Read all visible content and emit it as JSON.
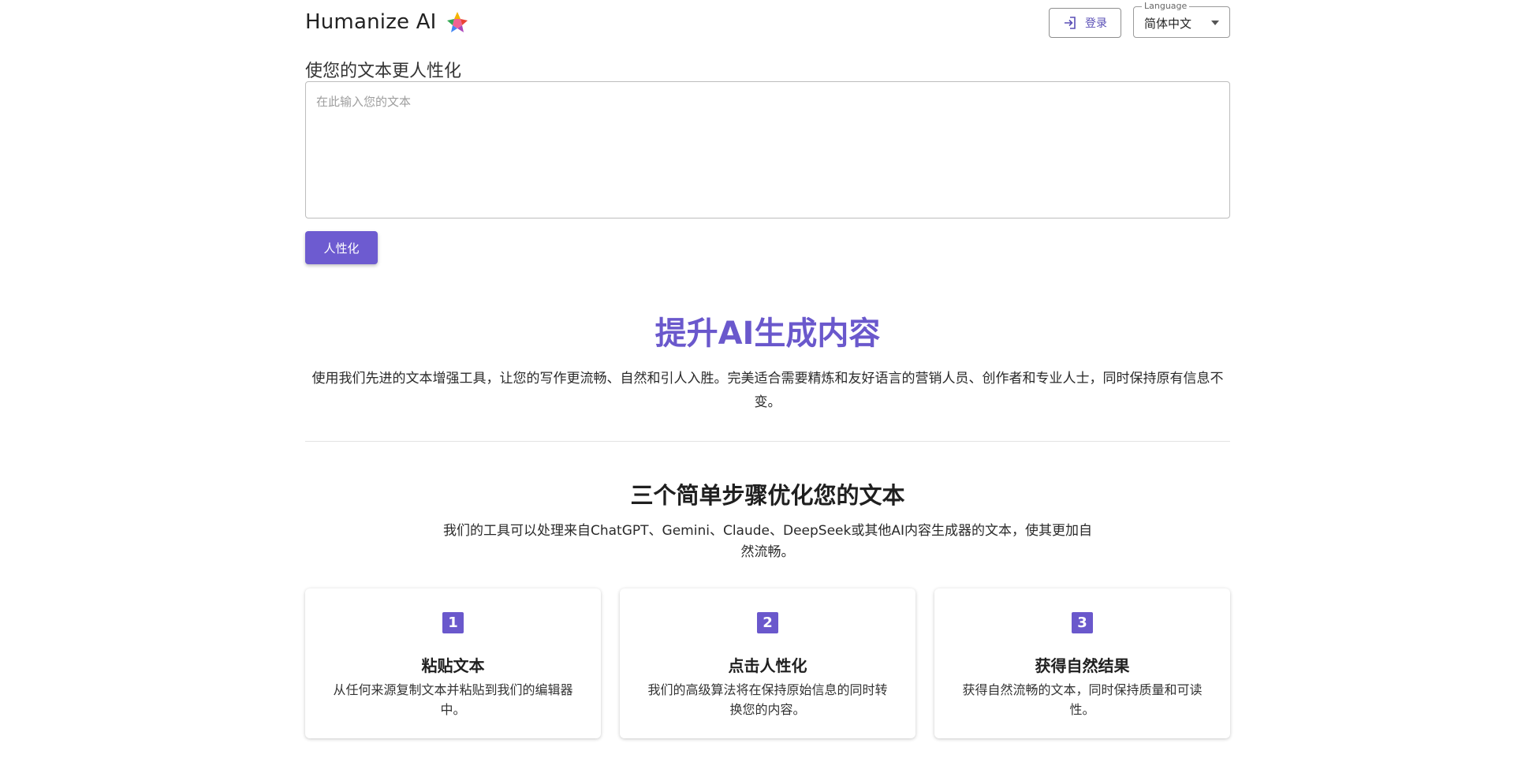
{
  "header": {
    "brand_name": "Humanize AI",
    "brand_icon": "multicolor-sparkle-logo",
    "login_label": "登录",
    "login_icon": "login-arrow-icon",
    "language_legend": "Language",
    "language_value": "简体中文"
  },
  "editor": {
    "title": "使您的文本更人性化",
    "placeholder": "在此输入您的文本",
    "value": "",
    "submit_label": "人性化"
  },
  "hero": {
    "title": "提升AI生成内容",
    "description": "使用我们先进的文本增强工具，让您的写作更流畅、自然和引人入胜。完美适合需要精炼和友好语言的营销人员、创作者和专业人士，同时保持原有信息不变。"
  },
  "steps": {
    "title": "三个简单步骤优化您的文本",
    "description": "我们的工具可以处理来自ChatGPT、Gemini、Claude、DeepSeek或其他AI内容生成器的文本，使其更加自然流畅。",
    "items": [
      {
        "number": "1",
        "title": "粘贴文本",
        "description": "从任何来源复制文本并粘贴到我们的编辑器中。"
      },
      {
        "number": "2",
        "title": "点击人性化",
        "description": "我们的高级算法将在保持原始信息的同时转换您的内容。"
      },
      {
        "number": "3",
        "title": "获得自然结果",
        "description": "获得自然流畅的文本，同时保持质量和可读性。"
      }
    ]
  },
  "colors": {
    "accent": "#6a58cc",
    "button": "#6d5bd0"
  }
}
